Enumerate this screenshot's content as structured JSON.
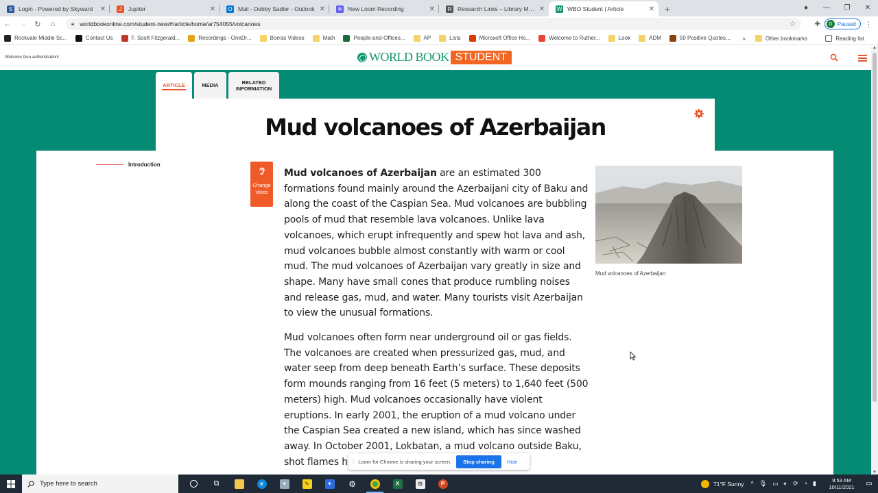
{
  "browser": {
    "tabs": [
      {
        "title": "Login - Powered by Skyward",
        "color": "#2b579a",
        "glyph": "S"
      },
      {
        "title": "Jupiter",
        "color": "#e8542a",
        "glyph": "J"
      },
      {
        "title": "Mail - Debby Sadler - Outlook",
        "color": "#0078d4",
        "glyph": "O"
      },
      {
        "title": "New Loom Recording",
        "color": "#625df5",
        "glyph": "*"
      },
      {
        "title": "Research Links – Library Media C",
        "color": "#555555",
        "glyph": "R"
      },
      {
        "title": "WBO Student | Article",
        "color": "#139671",
        "glyph": "W"
      }
    ],
    "url": "worldbookonline.com/student-new/#/article/home/ar754055/volcanoes",
    "profile_initial": "D",
    "profile_status": "Paused",
    "bookmarks": [
      {
        "label": "Rockvale Middle Sc...",
        "color": "#222"
      },
      {
        "label": "Contact Us",
        "color": "#111"
      },
      {
        "label": "F. Scott Fitzgerald...",
        "color": "#c0392b"
      },
      {
        "label": "Recordings - OneDr...",
        "color": "#e8a317"
      },
      {
        "label": "Borras Videos",
        "color": "folder"
      },
      {
        "label": "Math",
        "color": "folder"
      },
      {
        "label": "People-and-Offices...",
        "color": "#1e6b3a"
      },
      {
        "label": "AP",
        "color": "folder"
      },
      {
        "label": "Lists",
        "color": "folder"
      },
      {
        "label": "Microsoft Office Ho...",
        "color": "#d83b01"
      },
      {
        "label": "Welcome to Ruther...",
        "color": "#ea4335"
      },
      {
        "label": "Look",
        "color": "folder"
      },
      {
        "label": "ADM",
        "color": "folder"
      },
      {
        "label": "50 Positive Quotes...",
        "color": "#8b4513"
      }
    ],
    "bookmarks_right": {
      "more": "»",
      "other": "Other bookmarks",
      "reading": "Reading list"
    }
  },
  "site": {
    "welcome": "Welcome Geo-authentication!",
    "logo_text": "WORLD BOOK",
    "logo_badge": "STUDENT",
    "accent": "#e8542a",
    "brand_green": "#058a73"
  },
  "article_tabs": [
    {
      "label": "ARTICLE",
      "active": true
    },
    {
      "label": "MEDIA",
      "active": false
    },
    {
      "label": "RELATED INFORMATION",
      "active": false
    }
  ],
  "article": {
    "title": "Mud volcanoes of Azerbaijan",
    "toc_item": "Introduction",
    "change_voice": "Change Voice",
    "lead_bold": "Mud volcanoes of Azerbaijan",
    "para1_rest": " are an estimated 300 formations found mainly around the Azerbaijani city of Baku and along the coast of the Caspian Sea. Mud volcanoes are bubbling pools of mud that resemble lava volcanoes. Unlike lava volcanoes, which erupt infrequently and spew hot lava and ash, mud volcanoes bubble almost constantly with warm or cool mud. The mud volcanoes of Azerbaijan vary greatly in size and shape. Many have small cones that produce rumbling noises and release gas, mud, and water. Many tourists visit Azerbaijan to view the unusual formations.",
    "para2": "Mud volcanoes often form near underground oil or gas fields. The volcanoes are created when pressurized gas, mud, and water seep from deep beneath Earth’s surface. These deposits form mounds ranging from 16 feet (5 meters) to 1,640 feet (500 meters) high. Mud volcanoes occasionally have violent eruptions. In early 2001, the eruption of a mud volcano under the Caspian Sea created a new island, which has since washed away. In October 2001, Lokbatan, a mud volcano outside Baku, shot flames high into the",
    "image_caption": "Mud volcanoes of Azerbaijan"
  },
  "loom": {
    "message": "Loom for Chrome is sharing your screen.",
    "stop": "Stop sharing",
    "hide": "Hide"
  },
  "taskbar": {
    "search_placeholder": "Type here to search",
    "weather": "71°F  Sunny",
    "time": "9:53 AM",
    "date": "10/11/2021"
  }
}
